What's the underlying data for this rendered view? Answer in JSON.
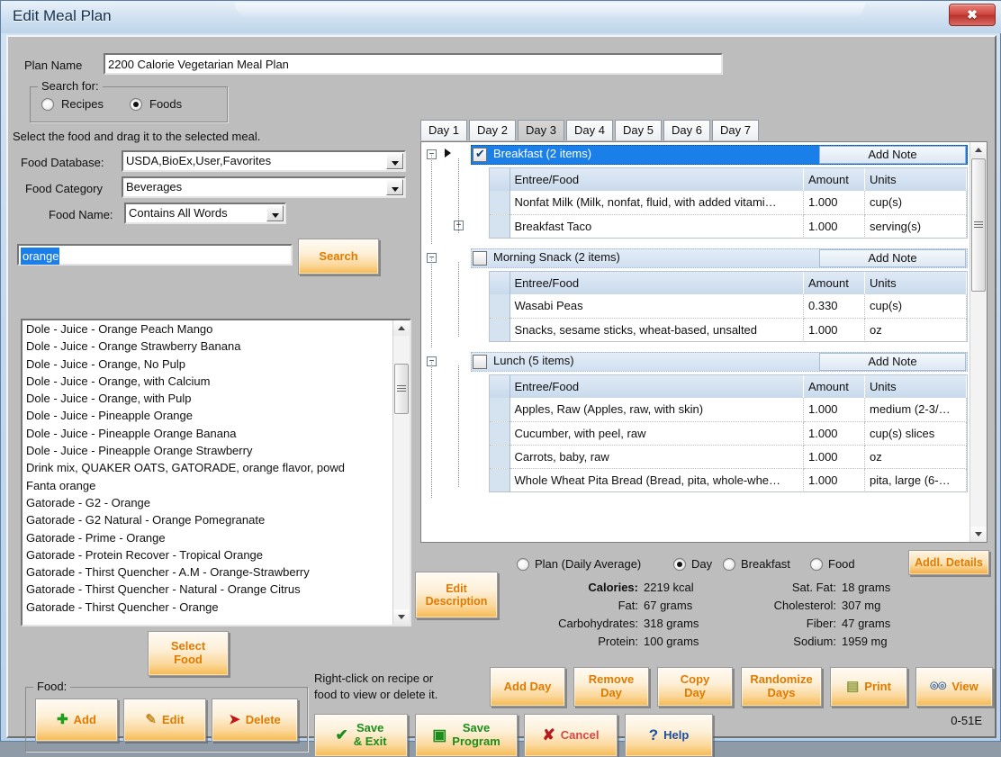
{
  "window": {
    "title": "Edit Meal Plan",
    "close_label": "✖",
    "version_code": "0-51E"
  },
  "plan": {
    "name_label": "Plan Name",
    "name_value": "2200 Calorie Vegetarian Meal Plan"
  },
  "search_for": {
    "legend": "Search for:",
    "options": [
      {
        "label": "Recipes",
        "selected": false
      },
      {
        "label": "Foods",
        "selected": true
      }
    ]
  },
  "hint": {
    "drag_text": "Select the food and drag it to the selected meal."
  },
  "filters": {
    "food_database_label": "Food Database:",
    "food_database_value": "USDA,BioEx,User,Favorites",
    "food_category_label": "Food Category",
    "food_category_value": "Beverages",
    "food_name_label": "Food Name:",
    "food_name_match_value": "Contains All Words",
    "search_term": "orange",
    "search_button": "Search"
  },
  "food_results": [
    "Dole - Juice - Orange Peach Mango",
    "Dole - Juice - Orange Strawberry Banana",
    "Dole - Juice - Orange, No Pulp",
    "Dole - Juice - Orange, with Calcium",
    "Dole - Juice - Orange, with Pulp",
    "Dole - Juice - Pineapple Orange",
    "Dole - Juice - Pineapple Orange Banana",
    "Dole - Juice - Pineapple Orange Strawberry",
    "Drink mix, QUAKER OATS, GATORADE, orange flavor, powd",
    "Fanta orange",
    "Gatorade - G2 - Orange",
    "Gatorade - G2 Natural - Orange Pomegranate",
    "Gatorade - Prime - Orange",
    "Gatorade - Protein Recover - Tropical Orange",
    "Gatorade - Thirst Quencher - A.M - Orange-Strawberry",
    "Gatorade - Thirst Quencher - Natural -  Orange Citrus",
    "Gatorade - Thirst Quencher - Orange"
  ],
  "select_food_button": "Select\nFood",
  "food_group": {
    "legend": "Food:",
    "buttons": [
      {
        "label": "Add",
        "icon": "plus-icon"
      },
      {
        "label": "Edit",
        "icon": "pencil-icon"
      },
      {
        "label": "Delete",
        "icon": "delete-icon"
      }
    ]
  },
  "day_tabs": [
    {
      "label": "Day 1",
      "active": false
    },
    {
      "label": "Day 2",
      "active": false
    },
    {
      "label": "Day 3",
      "active": true
    },
    {
      "label": "Day 4",
      "active": false
    },
    {
      "label": "Day 5",
      "active": false
    },
    {
      "label": "Day 6",
      "active": false
    },
    {
      "label": "Day 7",
      "active": false
    }
  ],
  "grid_headers": {
    "food": "Entree/Food",
    "amount": "Amount",
    "units": "Units"
  },
  "add_note_label": "Add Note",
  "meals": [
    {
      "title": "Breakfast (2 items)",
      "checked": true,
      "selected": true,
      "items": [
        {
          "food": "Nonfat Milk (Milk, nonfat, fluid, with added vitami…",
          "amount": "1.000",
          "units": "cup(s)",
          "expandable": false
        },
        {
          "food": "Breakfast Taco",
          "amount": "1.000",
          "units": "serving(s)",
          "expandable": true
        }
      ]
    },
    {
      "title": "Morning Snack (2 items)",
      "checked": false,
      "selected": false,
      "items": [
        {
          "food": "Wasabi Peas",
          "amount": "0.330",
          "units": "cup(s)",
          "expandable": false
        },
        {
          "food": "Snacks, sesame sticks, wheat-based, unsalted",
          "amount": "1.000",
          "units": "oz",
          "expandable": false
        }
      ]
    },
    {
      "title": "Lunch (5 items)",
      "checked": false,
      "selected": false,
      "items": [
        {
          "food": "Apples, Raw (Apples, raw, with skin)",
          "amount": "1.000",
          "units": "medium  (2-3/…",
          "expandable": false
        },
        {
          "food": "Cucumber, with peel, raw",
          "amount": "1.000",
          "units": "cup(s) slices",
          "expandable": false
        },
        {
          "food": "Carrots, baby, raw",
          "amount": "1.000",
          "units": "oz",
          "expandable": false
        },
        {
          "food": "Whole Wheat Pita Bread (Bread, pita, whole-whe…",
          "amount": "1.000",
          "units": "pita, large (6-…",
          "expandable": false
        }
      ]
    }
  ],
  "nutrition_scope": {
    "options": [
      {
        "label": "Plan (Daily Average)",
        "selected": false
      },
      {
        "label": "Day",
        "selected": true
      },
      {
        "label": "Breakfast",
        "selected": false
      },
      {
        "label": "Food",
        "selected": false
      }
    ],
    "addl_details_button": "Addl. Details"
  },
  "edit_description_button": "Edit\nDescription",
  "nutrition": {
    "left": [
      {
        "label": "Calories:",
        "value": "2219 kcal",
        "bold": true
      },
      {
        "label": "Fat:",
        "value": "67 grams",
        "bold": false
      },
      {
        "label": "Carbohydrates:",
        "value": "318 grams",
        "bold": false
      },
      {
        "label": "Protein:",
        "value": "100 grams",
        "bold": false
      }
    ],
    "right": [
      {
        "label": "Sat. Fat:",
        "value": "18 grams",
        "bold": false
      },
      {
        "label": "Cholesterol:",
        "value": "307 mg",
        "bold": false
      },
      {
        "label": "Fiber:",
        "value": "47 grams",
        "bold": false
      },
      {
        "label": "Sodium:",
        "value": "1959 mg",
        "bold": false
      }
    ]
  },
  "right_click_hint": "Right-click on recipe or\nfood to view or delete it.",
  "day_buttons": [
    {
      "label": "Add Day"
    },
    {
      "label": "Remove\nDay"
    },
    {
      "label": "Copy\nDay"
    },
    {
      "label": "Randomize\nDays"
    },
    {
      "label": "Print",
      "icon": "printer-icon"
    },
    {
      "label": "View",
      "icon": "glasses-icon"
    }
  ],
  "action_buttons": [
    {
      "label": "Save\n& Exit",
      "icon": "check-icon"
    },
    {
      "label": "Save\nProgram",
      "icon": "floppy-icon"
    },
    {
      "label": "Cancel",
      "icon": "x-icon"
    },
    {
      "label": "Help",
      "icon": "question-icon"
    }
  ],
  "colors": {
    "selection_blue": "#1a7fe8",
    "accent_orange": "#e07b00",
    "window_face": "#bdbdbd"
  }
}
